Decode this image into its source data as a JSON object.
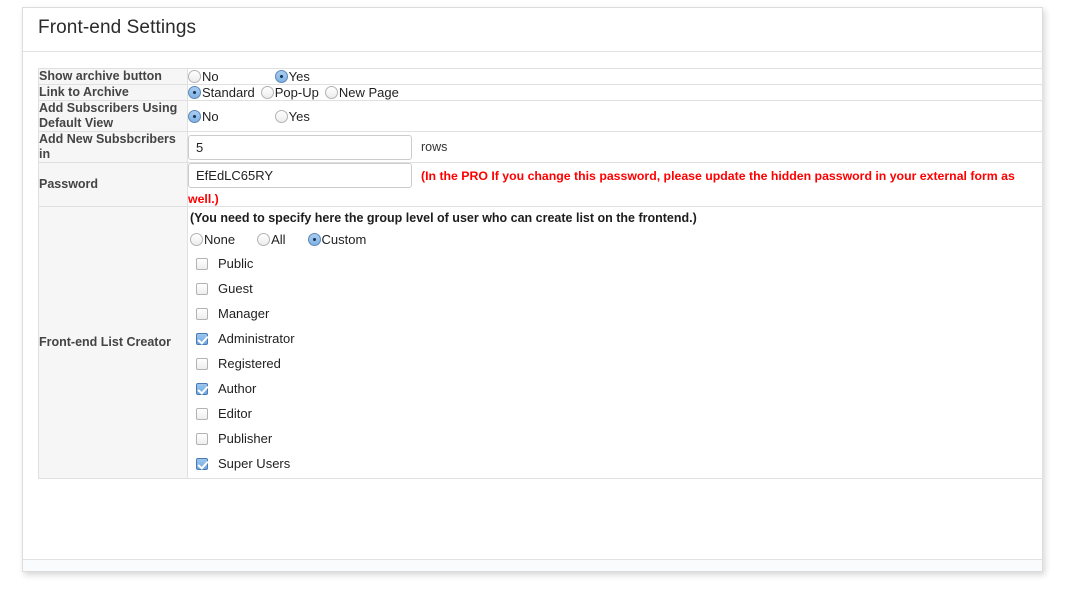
{
  "card": {
    "title": "Front-end Settings"
  },
  "rows": {
    "show_archive": {
      "label": "Show archive button",
      "options": [
        {
          "label": "No",
          "selected": false
        },
        {
          "label": "Yes",
          "selected": true
        }
      ]
    },
    "link_to_archive": {
      "label": "Link to Archive",
      "options": [
        {
          "label": "Standard",
          "selected": true
        },
        {
          "label": "Pop-Up",
          "selected": false
        },
        {
          "label": "New Page",
          "selected": false
        }
      ]
    },
    "add_subscribers_default_view": {
      "label": "Add Subscribers Using Default View",
      "options": [
        {
          "label": "No",
          "selected": true
        },
        {
          "label": "Yes",
          "selected": false
        }
      ]
    },
    "add_new_subscribers": {
      "label": "Add New Subsbcribers in",
      "value": "5",
      "suffix": "rows"
    },
    "password": {
      "label": "Password",
      "value": "EfEdLC65RY",
      "note_line1": "(In the PRO If you change this password, please update the hidden password in your external form as",
      "note_line2": "well.)"
    },
    "list_creator": {
      "label": "Front-end List Creator",
      "hint": "(You need to specify here the group level of user who can create list on the frontend.)",
      "options": [
        {
          "label": "None",
          "selected": false
        },
        {
          "label": "All",
          "selected": false
        },
        {
          "label": "Custom",
          "selected": true
        }
      ],
      "groups": [
        {
          "label": "Public",
          "checked": false
        },
        {
          "label": "Guest",
          "checked": false
        },
        {
          "label": "Manager",
          "checked": false
        },
        {
          "label": "Administrator",
          "checked": true
        },
        {
          "label": "Registered",
          "checked": false
        },
        {
          "label": "Author",
          "checked": true
        },
        {
          "label": "Editor",
          "checked": false
        },
        {
          "label": "Publisher",
          "checked": false
        },
        {
          "label": "Super Users",
          "checked": true
        }
      ]
    }
  }
}
